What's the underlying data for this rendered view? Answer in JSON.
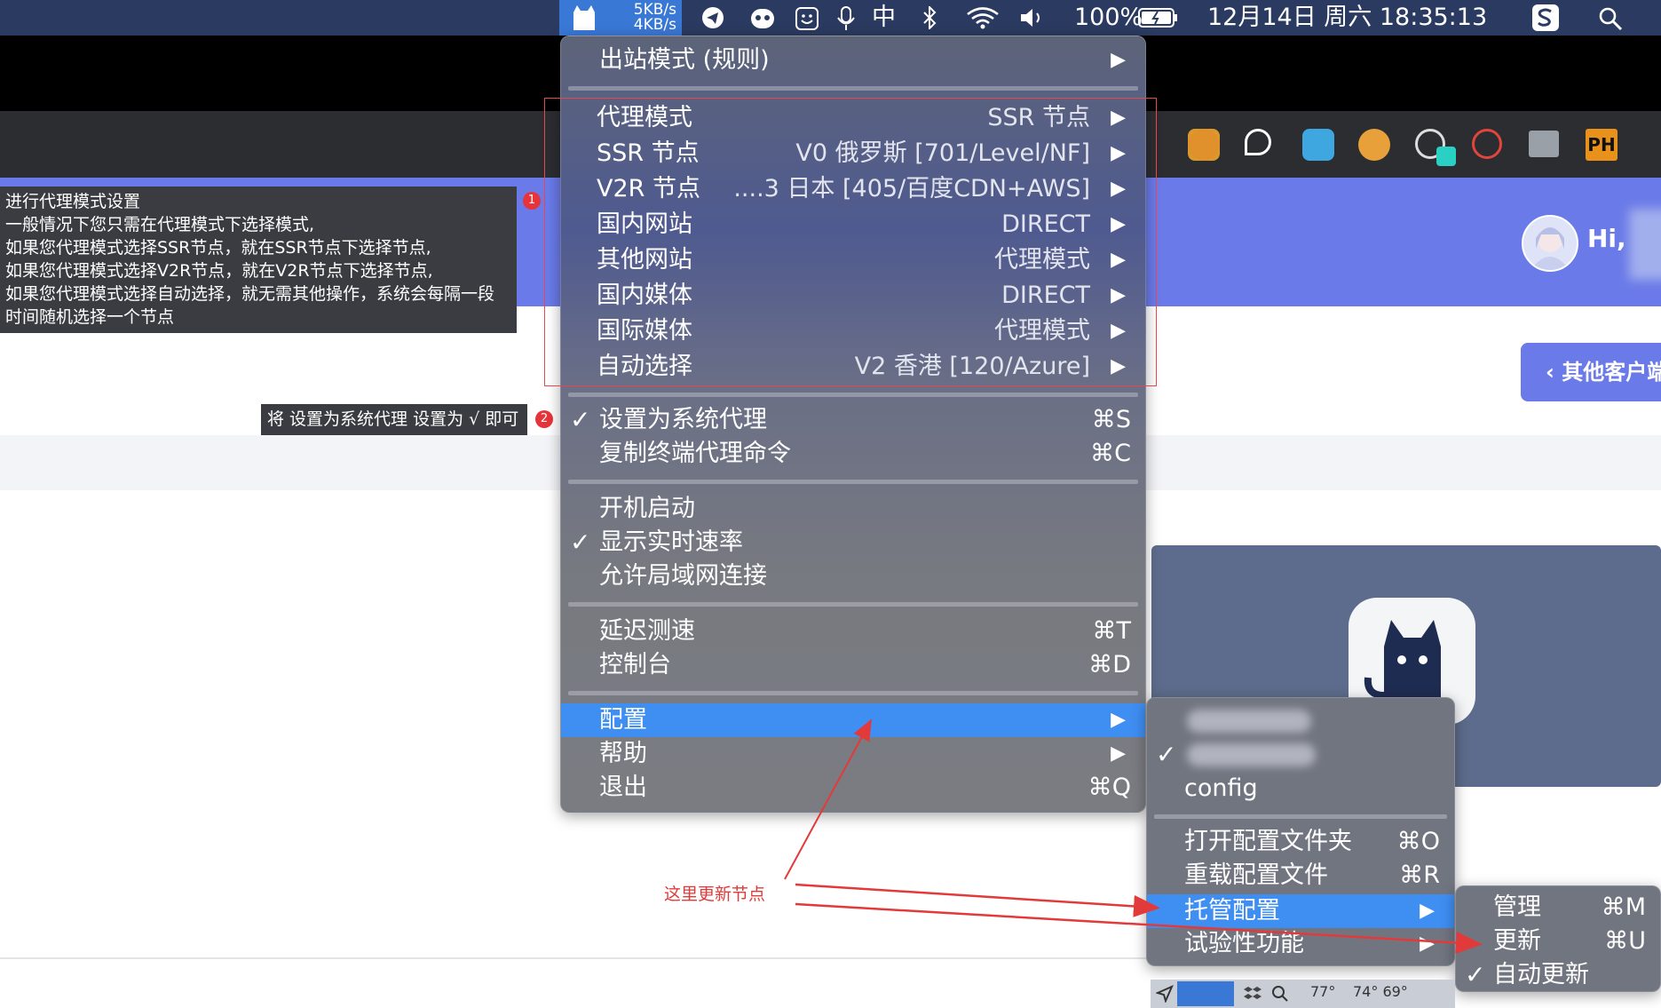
{
  "menubar": {
    "up_speed": "5KB/s",
    "down_speed": "4KB/s",
    "input_method": "中",
    "battery": "100%",
    "datetime": "12月14日 周六 18:35:13"
  },
  "page": {
    "greeting": "Hi,",
    "other_client_label": "其他客户端"
  },
  "tooltips": {
    "tip1_lines": [
      "进行代理模式设置",
      "一般情况下您只需在代理模式下选择模式,",
      "如果您代理模式选择SSR节点，就在SSR节点下选择节点,",
      "如果您代理模式选择V2R节点，就在V2R节点下选择节点,",
      "如果您代理模式选择自动选择，就无需其他操作，系统会每隔一段",
      "时间随机选择一个节点"
    ],
    "tip1_badge": "1",
    "tip2": "将 设置为系统代理 设置为 √ 即可",
    "tip2_badge": "2"
  },
  "main_menu": {
    "outbound_mode": "出站模式 (规则)",
    "proxy_groups": [
      {
        "label": "代理模式",
        "value": "SSR 节点"
      },
      {
        "label": "SSR 节点",
        "value": "V0 俄罗斯 [701/Level/NF]"
      },
      {
        "label": "V2R 节点",
        "value": "....3 日本 [405/百度CDN+AWS]"
      },
      {
        "label": "国内网站",
        "value": "DIRECT"
      },
      {
        "label": "其他网站",
        "value": "代理模式"
      },
      {
        "label": "国内媒体",
        "value": "DIRECT"
      },
      {
        "label": "国际媒体",
        "value": "代理模式"
      },
      {
        "label": "自动选择",
        "value": "V2 香港 [120/Azure]"
      }
    ],
    "set_system_proxy": {
      "label": "设置为系统代理",
      "shortcut": "⌘S",
      "check": "✓"
    },
    "copy_terminal": {
      "label": "复制终端代理命令",
      "shortcut": "⌘C"
    },
    "launch_at_login": "开机启动",
    "show_speed": {
      "label": "显示实时速率",
      "check": "✓"
    },
    "allow_lan": "允许局域网连接",
    "latency_test": {
      "label": "延迟测速",
      "shortcut": "⌘T"
    },
    "dashboard": {
      "label": "控制台",
      "shortcut": "⌘D"
    },
    "config": "配置",
    "help": "帮助",
    "quit": {
      "label": "退出",
      "shortcut": "⌘Q"
    },
    "arrow": "▶"
  },
  "config_submenu": {
    "profile_check": "✓",
    "profile3": "config",
    "open_folder": {
      "label": "打开配置文件夹",
      "shortcut": "⌘O"
    },
    "reload": {
      "label": "重载配置文件",
      "shortcut": "⌘R"
    },
    "managed": "托管配置",
    "experimental": "试验性功能"
  },
  "managed_submenu": {
    "manage": {
      "label": "管理",
      "shortcut": "⌘M"
    },
    "update": {
      "label": "更新",
      "shortcut": "⌘U"
    },
    "auto_update": {
      "label": "自动更新",
      "check": "✓"
    }
  },
  "annotation": "这里更新节点",
  "bottom_strip": {
    "temp1": "77°",
    "temp2": "74° 69°"
  },
  "colors": {
    "menubar": "#2b3a60",
    "highlight": "#3f8ef2",
    "header": "#6a7ae8",
    "annotation": "#e23a3a"
  }
}
